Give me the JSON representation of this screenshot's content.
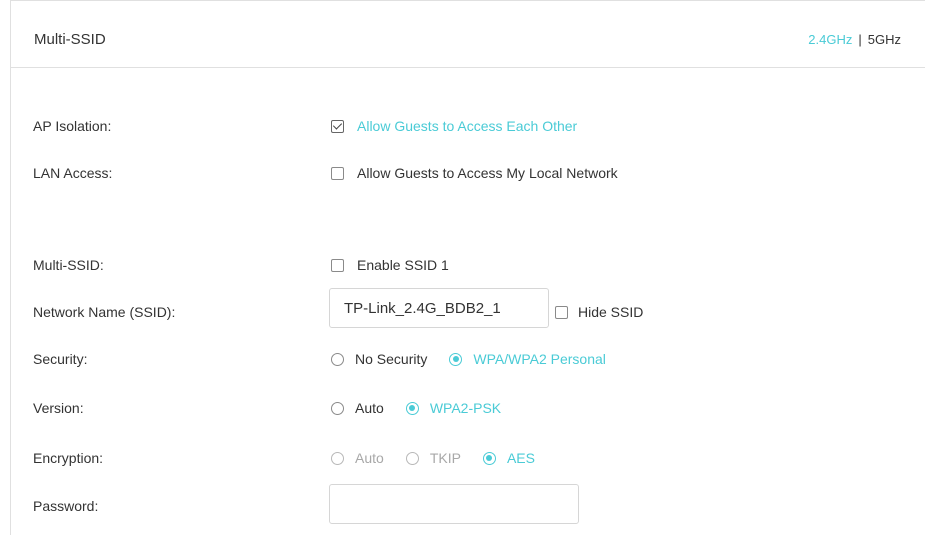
{
  "header": {
    "title": "Multi-SSID",
    "band_2g": "2.4GHz",
    "band_sep": "|",
    "band_5g": "5GHz"
  },
  "ap_isolation": {
    "label": "AP Isolation:",
    "checkbox_label": "Allow Guests to Access Each Other",
    "checked": true
  },
  "lan_access": {
    "label": "LAN Access:",
    "checkbox_label": "Allow Guests to Access My Local Network",
    "checked": false
  },
  "multi_ssid": {
    "label": "Multi-SSID:",
    "checkbox_label": "Enable SSID 1",
    "checked": false
  },
  "network_name": {
    "label": "Network Name (SSID):",
    "value": "TP-Link_2.4G_BDB2_1",
    "hide_label": "Hide SSID"
  },
  "security": {
    "label": "Security:",
    "options": [
      "No Security",
      "WPA/WPA2 Personal"
    ],
    "selected": "WPA/WPA2 Personal"
  },
  "version": {
    "label": "Version:",
    "options": [
      "Auto",
      "WPA2-PSK"
    ],
    "selected": "WPA2-PSK"
  },
  "encryption": {
    "label": "Encryption:",
    "options": [
      "Auto",
      "TKIP",
      "AES"
    ],
    "selected": "AES"
  },
  "password": {
    "label": "Password:",
    "value": ""
  },
  "colors": {
    "accent": "#4acbd6",
    "text": "#333333",
    "disabled": "#a8a8a8",
    "border": "#e0e0e0"
  }
}
